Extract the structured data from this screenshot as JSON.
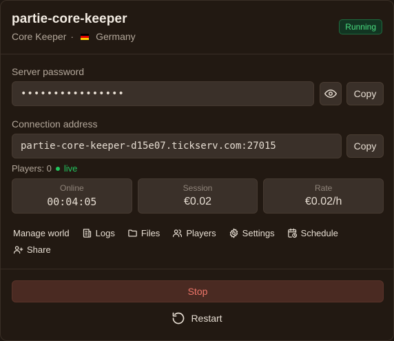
{
  "server": {
    "name": "partie-core-keeper",
    "game": "Core Keeper",
    "separator": "·",
    "country": "Germany",
    "status": "Running"
  },
  "password": {
    "label": "Server password",
    "value": "••••••••••••••••",
    "reveal_icon": "eye-icon",
    "copy_label": "Copy"
  },
  "connection": {
    "label": "Connection address",
    "value": "partie-core-keeper-d15e07.tickserv.com:27015",
    "copy_label": "Copy"
  },
  "players": {
    "label": "Players: 0",
    "live_label": "live"
  },
  "stats": [
    {
      "label": "Online",
      "value": "00:04:05"
    },
    {
      "label": "Session",
      "value": "€0.02"
    },
    {
      "label": "Rate",
      "value": "€0.02/h"
    }
  ],
  "actions": {
    "manage_world": "Manage world",
    "logs": "Logs",
    "files": "Files",
    "players": "Players",
    "settings": "Settings",
    "schedule": "Schedule",
    "share": "Share"
  },
  "controls": {
    "stop": "Stop",
    "restart": "Restart"
  },
  "colors": {
    "accent_green": "#22c55e",
    "danger": "#f0766a",
    "background": "#221912"
  }
}
